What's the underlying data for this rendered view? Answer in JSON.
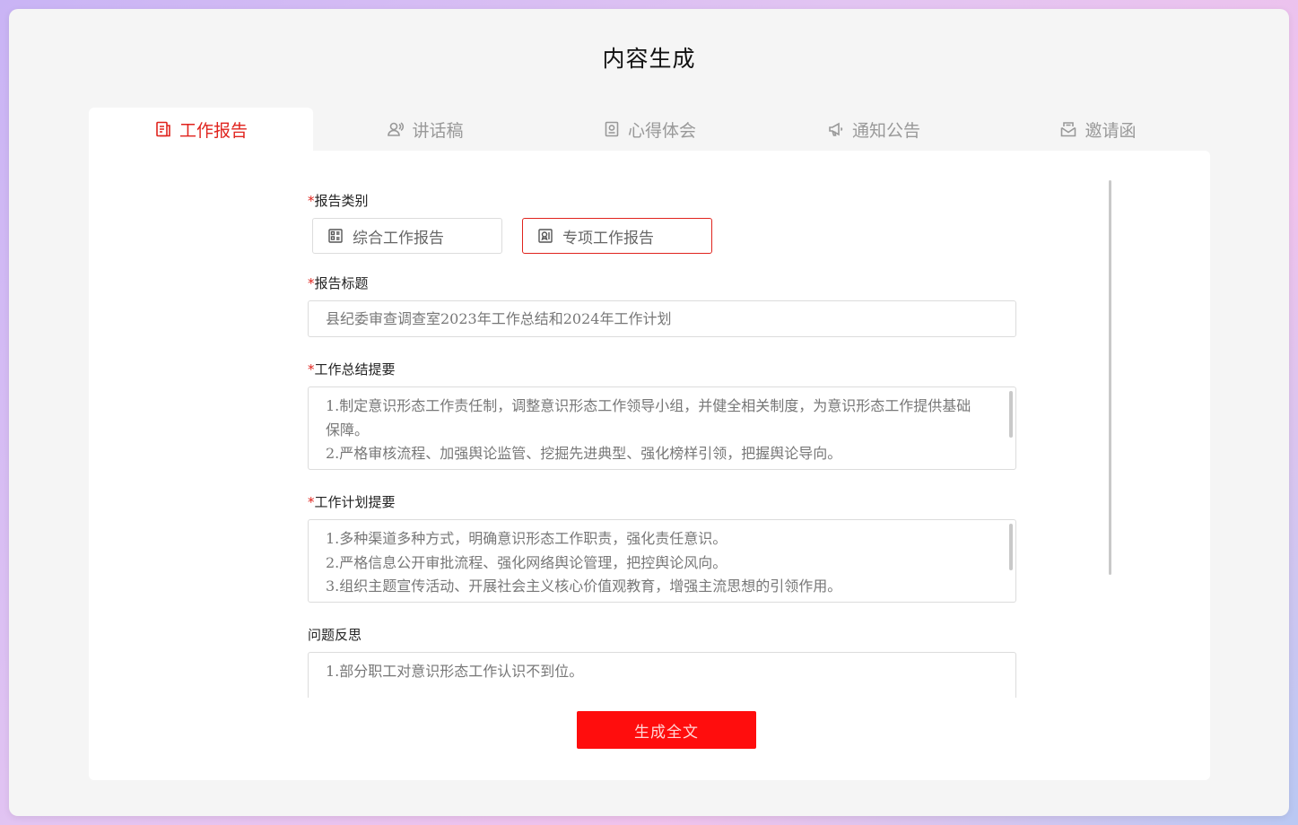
{
  "page": {
    "title": "内容生成"
  },
  "tabs": [
    {
      "label": "工作报告",
      "icon": "report-icon",
      "active": true
    },
    {
      "label": "讲话稿",
      "icon": "speaker-icon",
      "active": false
    },
    {
      "label": "心得体会",
      "icon": "notebook-icon",
      "active": false
    },
    {
      "label": "通知公告",
      "icon": "megaphone-icon",
      "active": false
    },
    {
      "label": "邀请函",
      "icon": "envelope-icon",
      "active": false
    }
  ],
  "form": {
    "report_type": {
      "required_mark": "*",
      "label": "报告类别",
      "options": [
        {
          "label": "综合工作报告",
          "icon": "grid-document-icon",
          "selected": false
        },
        {
          "label": "专项工作报告",
          "icon": "badge-document-icon",
          "selected": true
        }
      ]
    },
    "report_title": {
      "required_mark": "*",
      "label": "报告标题",
      "value": "县纪委审查调查室2023年工作总结和2024年工作计划"
    },
    "work_summary": {
      "required_mark": "*",
      "label": "工作总结提要",
      "lines": [
        "1.制定意识形态工作责任制，调整意识形态工作领导小组，并健全相关制度，为意识形态工作提供基础保障。",
        "2.严格审核流程、加强舆论监管、挖掘先进典型、强化榜样引领，把握舆论导向。"
      ]
    },
    "work_plan": {
      "required_mark": "*",
      "label": "工作计划提要",
      "lines": [
        "1.多种渠道多种方式，明确意识形态工作职责，强化责任意识。",
        "2.严格信息公开审批流程、强化网络舆论管理，把控舆论风向。",
        "3.组织主题宣传活动、开展社会主义核心价值观教育，增强主流思想的引领作用。"
      ]
    },
    "problem_reflection": {
      "label": "问题反思",
      "lines": [
        "1.部分职工对意识形态工作认识不到位。"
      ]
    }
  },
  "actions": {
    "generate_label": "生成全文"
  },
  "colors": {
    "accent": "#e0231d",
    "button": "#ff0d0d",
    "panel": "#ffffff",
    "window": "#f5f5f5"
  }
}
